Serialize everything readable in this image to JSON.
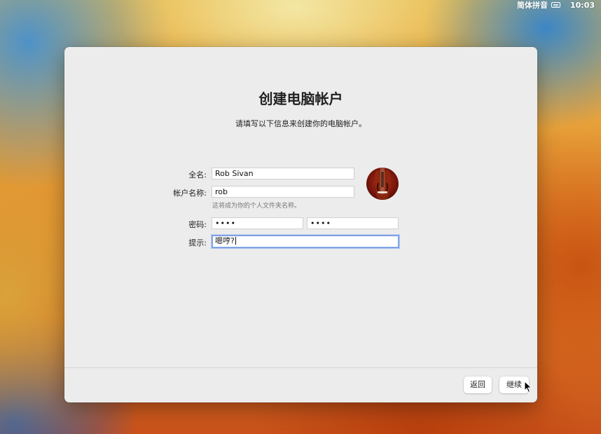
{
  "menubar": {
    "input_method": "简体拼音",
    "keyboard_icon": "keyboard-icon",
    "clock": "10:03"
  },
  "dialog": {
    "title": "创建电脑帐户",
    "subtitle": "请填写以下信息来创建你的电脑帐户。",
    "fullname": {
      "label": "全名:",
      "value": "Rob Sivan"
    },
    "account": {
      "label": "帐户名称:",
      "value": "rob",
      "helper": "这将成为你的个人文件夹名称。"
    },
    "password": {
      "label": "密码:",
      "value": "••••",
      "verify": "••••"
    },
    "hint": {
      "label": "提示:",
      "value": "嗯哼?"
    },
    "avatar_icon": "violin-avatar-icon",
    "back_label": "返回",
    "continue_label": "继续"
  },
  "colors": {
    "focus_ring": "#7fa3e6",
    "window_bg": "#ececec"
  }
}
